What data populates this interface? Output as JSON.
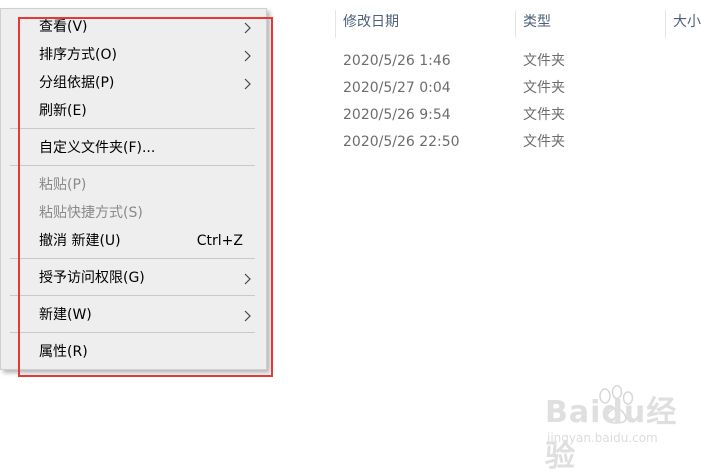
{
  "file_list": {
    "columns": [
      "修改日期",
      "类型",
      "大小"
    ],
    "rows": [
      {
        "date": "2020/5/26 1:46",
        "type": "文件夹"
      },
      {
        "date": "2020/5/27 0:04",
        "type": "文件夹"
      },
      {
        "date": "2020/5/26 9:54",
        "type": "文件夹"
      },
      {
        "date": "2020/5/26 22:50",
        "type": "文件夹"
      }
    ]
  },
  "context_menu": {
    "items": [
      {
        "label": "查看(V)",
        "submenu": true,
        "enabled": true
      },
      {
        "label": "排序方式(O)",
        "submenu": true,
        "enabled": true
      },
      {
        "label": "分组依据(P)",
        "submenu": true,
        "enabled": true
      },
      {
        "label": "刷新(E)",
        "submenu": false,
        "enabled": true
      },
      {
        "label": "自定义文件夹(F)...",
        "submenu": false,
        "enabled": true
      },
      {
        "label": "粘贴(P)",
        "submenu": false,
        "enabled": false
      },
      {
        "label": "粘贴快捷方式(S)",
        "submenu": false,
        "enabled": false
      },
      {
        "label": "撤消 新建(U)",
        "shortcut": "Ctrl+Z",
        "submenu": false,
        "enabled": true
      },
      {
        "label": "授予访问权限(G)",
        "submenu": true,
        "enabled": true
      },
      {
        "label": "新建(W)",
        "submenu": true,
        "enabled": true
      },
      {
        "label": "属性(R)",
        "submenu": false,
        "enabled": true
      }
    ]
  },
  "watermark": {
    "brand": "Baidu经验",
    "url": "jingyan.baidu.com"
  },
  "colors": {
    "highlight_border": "#e53935",
    "menu_background": "#eeeeee",
    "header_text": "#4c607a"
  }
}
